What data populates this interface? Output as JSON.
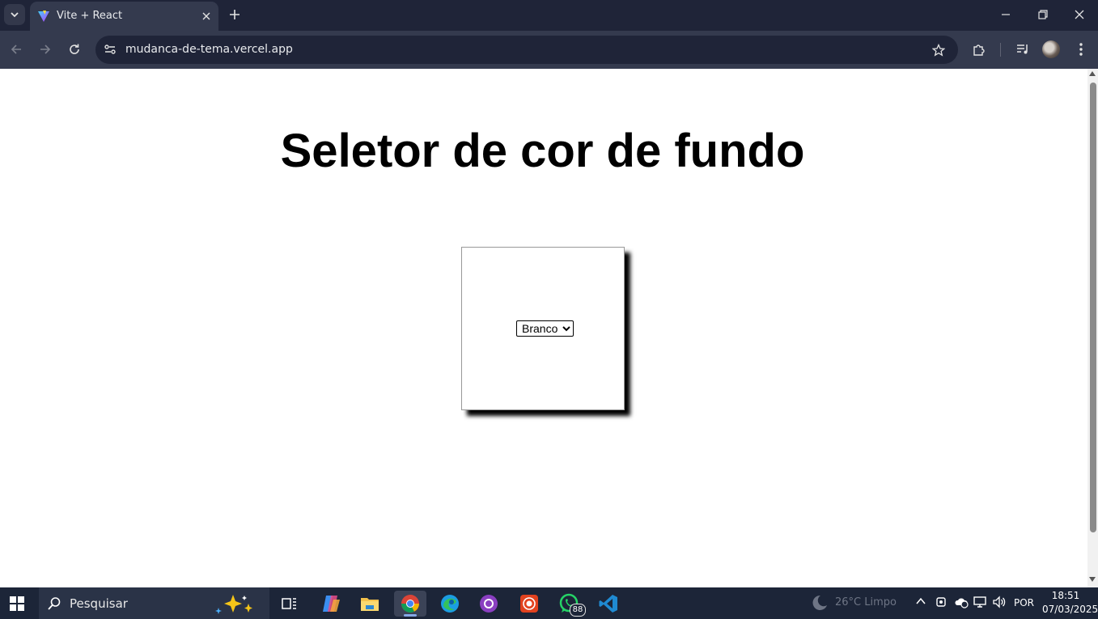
{
  "browser": {
    "tab": {
      "title": "Vite + React",
      "favicon": "vite-logo-icon"
    },
    "address": {
      "url": "mudanca-de-tema.vercel.app"
    },
    "icons": [
      "tab-search-icon",
      "close-icon",
      "plus-icon",
      "minimize-icon",
      "restore-icon",
      "back-icon",
      "forward-icon",
      "reload-icon",
      "site-info-icon",
      "star-icon",
      "extensions-icon",
      "media-control-icon",
      "avatar",
      "more-icon"
    ]
  },
  "page": {
    "title": "Seletor de cor de fundo",
    "selector": {
      "selected": "Branco",
      "options": [
        "Branco"
      ]
    }
  },
  "taskbar": {
    "search_placeholder": "Pesquisar",
    "apps": [
      "task-view",
      "copilot",
      "file-explorer",
      "chrome",
      "edge",
      "github-desktop",
      "screen-recorder",
      "whatsapp",
      "vscode"
    ],
    "whatsapp_badge": "88",
    "weather": "26°C  Limpo",
    "language": "POR",
    "time": "18:51",
    "date": "07/03/2025"
  },
  "colors": {
    "tabstrip_bg": "#1f2438",
    "toolbar_bg": "#343a4e",
    "taskbar_bg": "#1c2538",
    "page_bg": "#ffffff"
  }
}
